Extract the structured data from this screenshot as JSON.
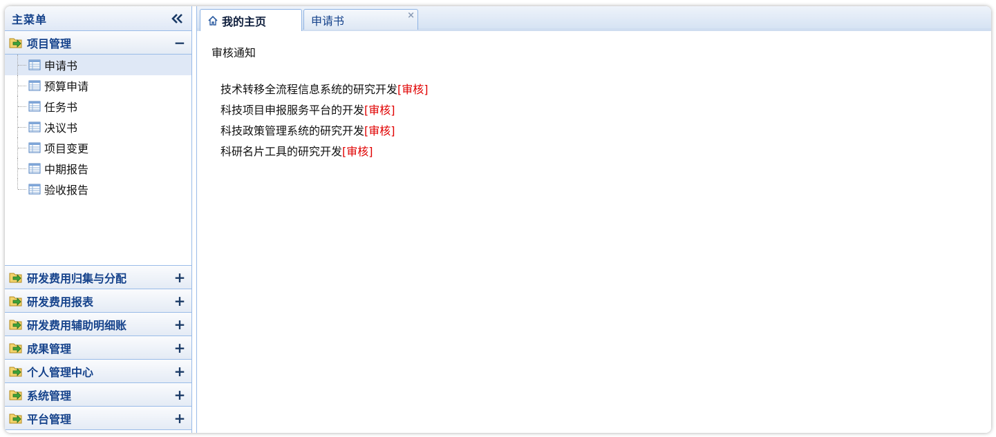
{
  "sidebar": {
    "title": "主菜单",
    "sections": [
      {
        "label": "项目管理",
        "toggle": "−",
        "items": [
          {
            "label": "申请书"
          },
          {
            "label": "预算申请"
          },
          {
            "label": "任务书"
          },
          {
            "label": "决议书"
          },
          {
            "label": "项目变更"
          },
          {
            "label": "中期报告"
          },
          {
            "label": "验收报告"
          }
        ]
      },
      {
        "label": "研发费用归集与分配",
        "toggle": "+"
      },
      {
        "label": "研发费用报表",
        "toggle": "+"
      },
      {
        "label": "研发费用辅助明细账",
        "toggle": "+"
      },
      {
        "label": "成果管理",
        "toggle": "+"
      },
      {
        "label": "个人管理中心",
        "toggle": "+"
      },
      {
        "label": "系统管理",
        "toggle": "+"
      },
      {
        "label": "平台管理",
        "toggle": "+"
      }
    ]
  },
  "tabs": [
    {
      "label": "我的主页"
    },
    {
      "label": "申请书",
      "close": "×"
    }
  ],
  "content": {
    "title": "审核通知",
    "notices": [
      {
        "text": "技术转移全流程信息系统的研究开发",
        "action": "[审核]"
      },
      {
        "text": "科技项目申报服务平台的开发",
        "action": "[审核]"
      },
      {
        "text": "科技政策管理系统的研究开发",
        "action": "[审核]"
      },
      {
        "text": "科研名片工具的研究开发",
        "action": "[审核]"
      }
    ]
  },
  "colors": {
    "accent": "#15428b",
    "border": "#99bbe8",
    "selected": "#dfe8f6",
    "review_link": "#e00000"
  }
}
